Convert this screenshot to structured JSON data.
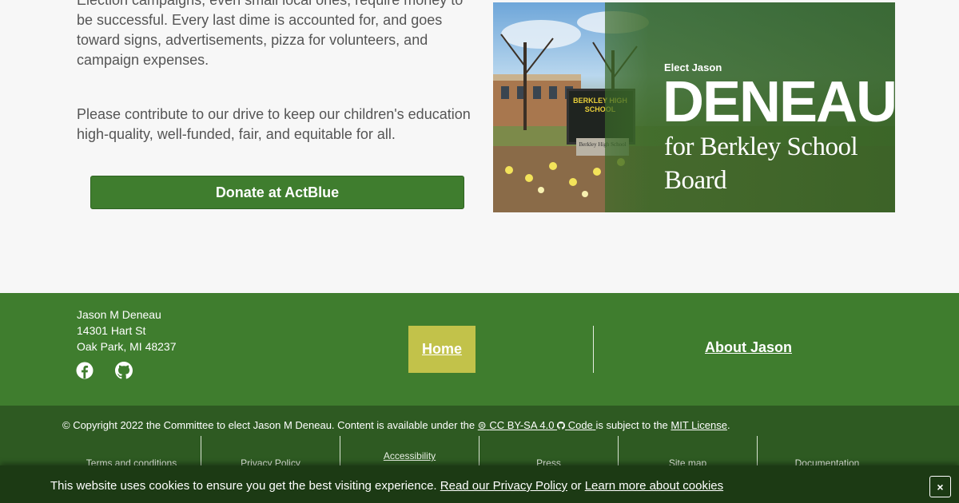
{
  "content": {
    "paragraph_1": "Election campaigns, even small local ones, require money to be successful. Every last dime is accounted for, and goes toward signs, advertisements, pizza for volunteers, and campaign expenses.",
    "paragraph_2": "Please contribute to our drive to keep our children's education high-quality, well-funded, fair, and equitable for all.",
    "donate_label": "Donate at ActBlue"
  },
  "banner": {
    "elect_label": "Elect Jason",
    "name": "DENEAU",
    "subtitle": "for Berkley School Board",
    "sign_text": "BERKLEY HIGH SCHOOL",
    "sign_base_text": "Berkley High School"
  },
  "footer": {
    "address": {
      "name": "Jason M Deneau",
      "street": "14301 Hart St",
      "city": "Oak Park, MI 48237"
    },
    "social": [
      "facebook-icon",
      "github-icon"
    ],
    "nav": {
      "home": "Home",
      "about": "About Jason"
    }
  },
  "legal": {
    "copyright_prefix": "© Copyright 2022 the Committee to elect Jason M Deneau. Content is available under the",
    "license_link": "CC BY-SA 4.0",
    "code_link": "Code",
    "code_suffix": "is subject to the",
    "mit_link": "MIT License",
    "end": ".",
    "links": [
      "Terms and conditions",
      "Privacy Policy",
      "Accessibility",
      "Press",
      "Site map",
      "Documentation"
    ]
  },
  "cookie": {
    "message": "This website uses cookies to ensure you get the best visiting experience.",
    "privacy_link": "Read our Privacy Policy",
    "or": "or",
    "learn_link": "Learn more about cookies",
    "close_label": "×"
  },
  "colors": {
    "primary_green": "#3f7d2e",
    "dark_green": "#2e5a22",
    "cookie_bg": "#1c3a14",
    "home_highlight": "#c2c24a"
  }
}
